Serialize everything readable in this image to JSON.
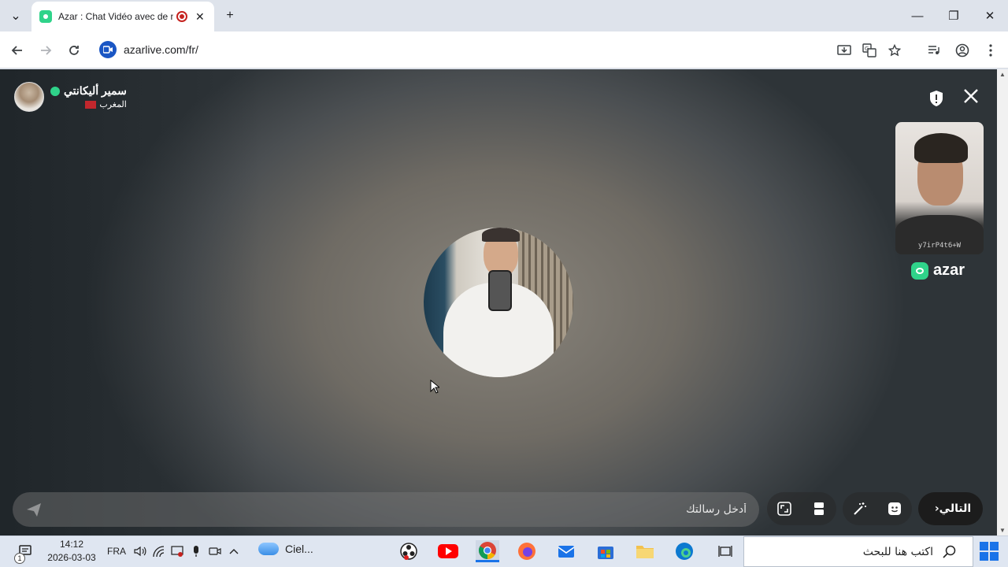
{
  "browser": {
    "tab_title": "Azar : Chat Vidéo avec de n",
    "url": "azarlive.com/fr/",
    "tab_close": "✕",
    "new_tab": "+",
    "tab_list": "⌄"
  },
  "window": {
    "minimize": "—",
    "restore": "❐",
    "close": "✕"
  },
  "peer": {
    "name": "سمير أليكانتي",
    "country": "المغرب",
    "flag_color": "#c1272d"
  },
  "self_cam": {
    "tag": "y7irP4t6+W"
  },
  "brand": {
    "name": "azar",
    "color": "#2fd38a"
  },
  "chat": {
    "placeholder": "أدخل رسالتك"
  },
  "controls": {
    "next_label": "التالي",
    "next_chevron": "‹"
  },
  "taskbar": {
    "notification_count": "1",
    "time": "14:12",
    "date": "2026-03-03",
    "language": "FRA",
    "weather_label": "Ciel...",
    "search_placeholder": "اكتب هنا للبحث"
  },
  "colors": {
    "accent": "#1a73e8",
    "brand_green": "#2fd38a"
  }
}
